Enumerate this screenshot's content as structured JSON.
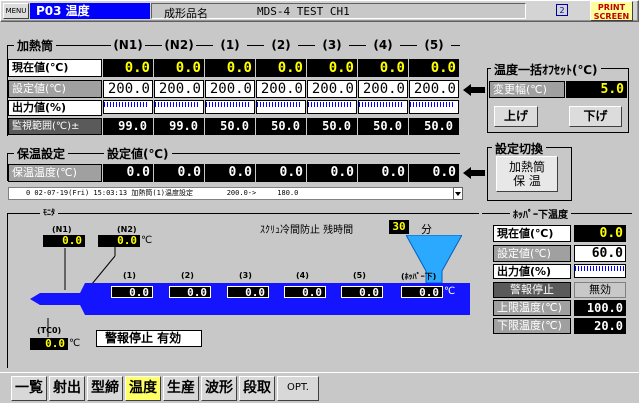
{
  "header": {
    "menu": "MENU",
    "screen_id": "P03 温度",
    "product_label": "成形品名",
    "product_name": "MDS-4 TEST CH1",
    "page_no": "2",
    "print_line1": "PRINT",
    "print_line2": "SCREEN"
  },
  "heater": {
    "title": "加熱筒",
    "columns": [
      "(N1)",
      "(N2)",
      "(1)",
      "(2)",
      "(3)",
      "(4)",
      "(5)"
    ],
    "current_label": "現在値(℃)",
    "current": [
      "0.0",
      "0.0",
      "0.0",
      "0.0",
      "0.0",
      "0.0",
      "0.0"
    ],
    "set_label": "設定値(℃)",
    "set": [
      "200.0",
      "200.0",
      "200.0",
      "200.0",
      "200.0",
      "200.0",
      "200.0"
    ],
    "output_label": "出力値(%)",
    "output_percent": [
      5,
      5,
      5,
      5,
      5,
      5,
      5
    ],
    "monitor_label": "監視範囲(℃)±",
    "monitor": [
      "99.0",
      "99.0",
      "50.0",
      "50.0",
      "50.0",
      "50.0",
      "50.0"
    ]
  },
  "bulk": {
    "title": "温度一括ｵﾌｾｯﾄ(℃)",
    "change_label": "変更幅(℃)",
    "change_value": "5.0",
    "up_label": "上げ",
    "down_label": "下げ"
  },
  "hold": {
    "title": "保温設定",
    "set_title": "設定値(℃)",
    "row_label": "保温温度(℃)",
    "values": [
      "0.0",
      "0.0",
      "0.0",
      "0.0",
      "0.0",
      "0.0",
      "0.0"
    ]
  },
  "switch": {
    "title": "設定切換",
    "button_line1": "加熱筒",
    "button_line2": "保 温"
  },
  "log": {
    "text": "0 02-07-19(Fri) 15:03:13 加熱筒(1)温度設定        200.0->     180.0"
  },
  "monitor": {
    "title": "ﾓﾆﾀ",
    "screw_label": "ｽｸﾘｭ冷間防止 残時間",
    "screw_value": "30",
    "screw_unit": "分",
    "n1_label": "(N1)",
    "n1_value": "0.0",
    "n2_label": "(N2)",
    "n2_value": "0.0",
    "n2_unit": "℃",
    "zone_labels": [
      "(1)",
      "(2)",
      "(3)",
      "(4)",
      "(5)",
      "(ﾎｯﾊﾟｰ下)"
    ],
    "zone_values": [
      "0.0",
      "0.0",
      "0.0",
      "0.0",
      "0.0",
      "0.0"
    ],
    "zone_unit": "℃",
    "tc0_label": "(TC0)",
    "tc0_value": "0.0",
    "tc0_unit": "℃",
    "alarm_text": "警報停止 有効"
  },
  "hopper": {
    "title": "ﾎｯﾊﾟｰ下温度",
    "current_label": "現在値(℃)",
    "current": "0.0",
    "set_label": "設定値(℃)",
    "set": "60.0",
    "output_label": "出力値(%)",
    "output_percent": 5,
    "alarm_label": "警報停止",
    "alarm_value": "無効",
    "upper_label": "上限温度(℃)",
    "upper": "100.0",
    "lower_label": "下限温度(℃)",
    "lower": "20.0"
  },
  "tabs": [
    {
      "label": "一覧",
      "active": false
    },
    {
      "label": "射出",
      "active": false
    },
    {
      "label": "型締",
      "active": false
    },
    {
      "label": "温度",
      "active": true
    },
    {
      "label": "生産",
      "active": false
    },
    {
      "label": "波形",
      "active": false
    },
    {
      "label": "段取",
      "active": false
    },
    {
      "label": "OPT.",
      "active": false
    }
  ],
  "colors": {
    "active_tab": "#ffff66",
    "screen_id_bg": "#0000ff",
    "screw_body": "#1414ff",
    "hopper_cone": "#2aa9ff",
    "value_text": "#ffff00"
  }
}
